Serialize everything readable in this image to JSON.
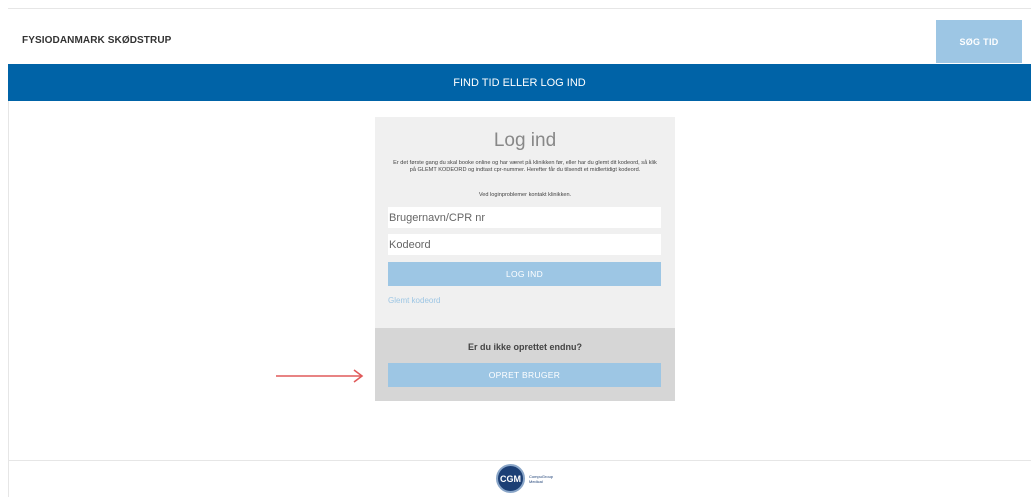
{
  "header": {
    "clinic_name": "FYSIODANMARK SKØDSTRUP",
    "search_button": "SØG TID"
  },
  "banner": {
    "title": "FIND TID ELLER LOG IND"
  },
  "login": {
    "title": "Log ind",
    "info": "Er det første gang du skal booke online og har været på klinikken før, eller har du glemt dit kodeord, så klik på GLEMT KODEORD og indtast cpr-nummer. Herefter får du tilsendt et midlertidigt kodeord.",
    "info2": "Ved loginproblemer kontakt klinikken.",
    "username_placeholder": "Brugernavn/CPR nr",
    "password_placeholder": "Kodeord",
    "login_button": "LOG IND",
    "forgot_link": "Glemt kodeord"
  },
  "register": {
    "prompt": "Er du ikke oprettet endnu?",
    "create_button": "OPRET BRUGER"
  },
  "footer": {
    "logo_mark": "CGM",
    "logo_text_line1": "CompuGroup",
    "logo_text_line2": "Medical"
  },
  "colors": {
    "banner": "#0063a7",
    "button": "#9dc6e4",
    "arrow": "#e05a5a"
  }
}
